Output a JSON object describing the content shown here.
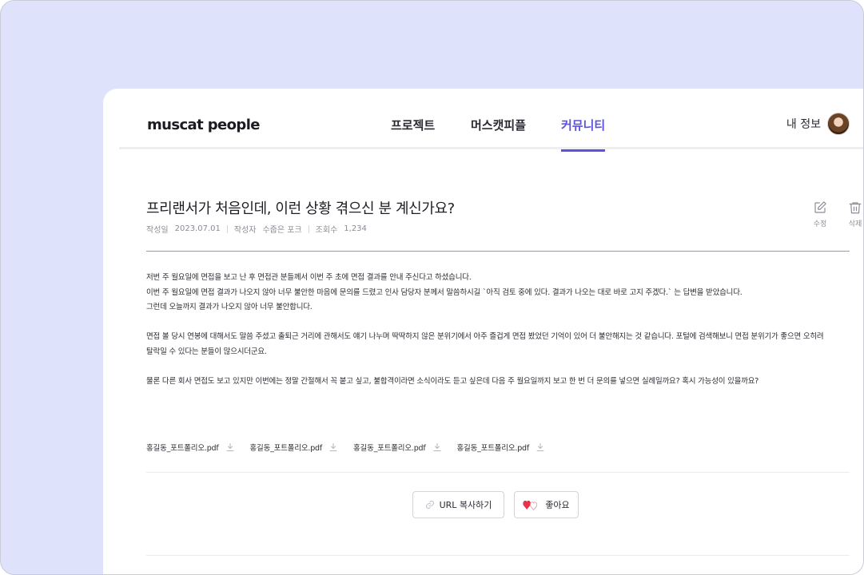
{
  "header": {
    "logo": "muscat people",
    "nav": [
      "프로젝트",
      "머스캣피플",
      "커뮤니티"
    ],
    "active_nav": "커뮤니티",
    "my_info": "내 정보"
  },
  "post": {
    "title": "프리랜서가 처음인데, 이런 상황 겪으신 분 계신가요?",
    "meta": {
      "date_label": "작성일",
      "date": "2023.07.01",
      "author_label": "작성자",
      "author": "수줍은 포크",
      "views_label": "조회수",
      "views": "1,234"
    },
    "actions": {
      "edit": "수정",
      "delete": "삭제"
    },
    "paragraphs": [
      "저번 주 월요일에 면접을 보고 난 후 면접관 분들께서 이번 주 초에 면접 결과를 안내 주신다고 하셨습니다.\n이번 주 월요일에 면접 결과가 나오지 않아 너무 불안한 마음에 문의를 드렸고 인사 담당자 분께서 말씀하시길 `아직 검토 중에 있다. 결과가 나오는 대로 바로 고지 주겠다.` 는 답변을 받았습니다.\n그런데 오늘까지 결과가 나오지 않아 너무 불안합니다.",
      "면접 볼 당시 연봉에 대해서도 말씀 주셨고 출퇴근 거리에 관해서도 얘기 나누며 딱딱하지 않은 분위기에서 아주 즐겁게 면접 봤었던 기억이 있어 더 불안해지는 것 같습니다. 포털에 검색해보니 면접 분위기가 좋으면 오히려\n탈락일 수 있다는 분들이 많으시더군요.",
      "물론 다른 회사 면접도 보고 있지만 이번에는 정말 간절해서 꼭 붙고 싶고, 불합격이라면 소식이라도 듣고 싶은데 다음 주 월요일까지 보고 한 번 더 문의를 넣으면 실례일까요? 혹시 가능성이 있을까요?"
    ],
    "attachments": [
      "홍길동_포트폴리오.pdf",
      "홍길동_포트폴리오.pdf",
      "홍길동_포트폴리오.pdf",
      "홍길동_포트폴리오.pdf"
    ],
    "buttons": {
      "copy_url": "URL 복사하기",
      "like": "좋아요"
    }
  },
  "colors": {
    "accent": "#5b52e0",
    "background": "#dfe2fb",
    "heart": "#e5334b"
  },
  "icons": [
    "edit-icon",
    "trash-icon",
    "download-icon",
    "link-icon",
    "heart-icon"
  ]
}
